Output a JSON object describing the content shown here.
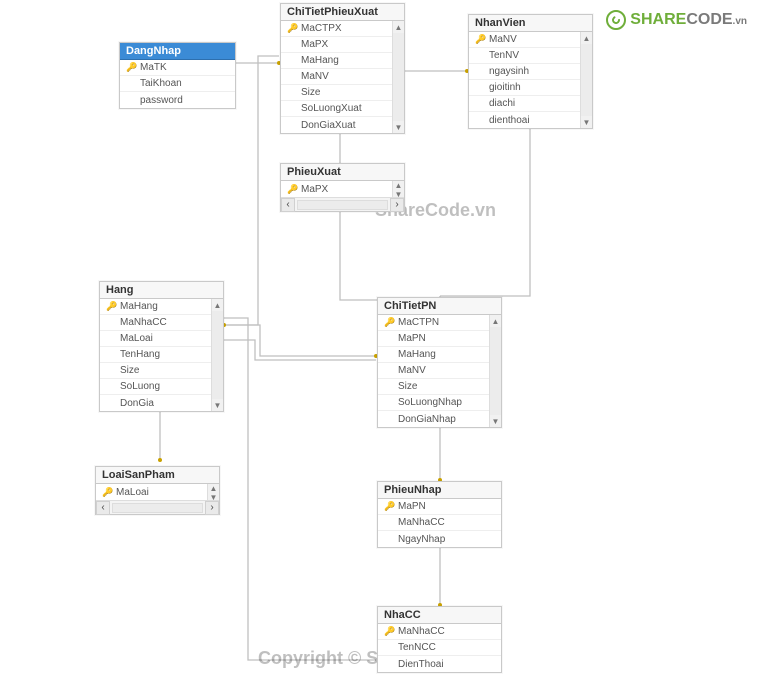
{
  "brand": {
    "share": "SHARE",
    "code": "CODE",
    "vn": ".vn"
  },
  "watermarks": {
    "w1": "ShareCode.vn",
    "w2": "Copyright © ShareCode.vn"
  },
  "tables": {
    "DangNhap": {
      "title": "DangNhap",
      "fields": [
        {
          "k": true,
          "n": "MaTK"
        },
        {
          "k": false,
          "n": "TaiKhoan"
        },
        {
          "k": false,
          "n": "password"
        }
      ]
    },
    "ChiTietPhieuXuat": {
      "title": "ChiTietPhieuXuat",
      "fields": [
        {
          "k": true,
          "n": "MaCTPX"
        },
        {
          "k": false,
          "n": "MaPX"
        },
        {
          "k": false,
          "n": "MaHang"
        },
        {
          "k": false,
          "n": "MaNV"
        },
        {
          "k": false,
          "n": "Size"
        },
        {
          "k": false,
          "n": "SoLuongXuat"
        },
        {
          "k": false,
          "n": "DonGiaXuat"
        }
      ]
    },
    "NhanVien": {
      "title": "NhanVien",
      "fields": [
        {
          "k": true,
          "n": "MaNV"
        },
        {
          "k": false,
          "n": "TenNV"
        },
        {
          "k": false,
          "n": "ngaysinh"
        },
        {
          "k": false,
          "n": "gioitinh"
        },
        {
          "k": false,
          "n": "diachi"
        },
        {
          "k": false,
          "n": "dienthoai"
        }
      ]
    },
    "PhieuXuat": {
      "title": "PhieuXuat",
      "fields": [
        {
          "k": true,
          "n": "MaPX"
        }
      ]
    },
    "Hang": {
      "title": "Hang",
      "fields": [
        {
          "k": true,
          "n": "MaHang"
        },
        {
          "k": false,
          "n": "MaNhaCC"
        },
        {
          "k": false,
          "n": "MaLoai"
        },
        {
          "k": false,
          "n": "TenHang"
        },
        {
          "k": false,
          "n": "Size"
        },
        {
          "k": false,
          "n": "SoLuong"
        },
        {
          "k": false,
          "n": "DonGia"
        }
      ]
    },
    "ChiTietPN": {
      "title": "ChiTietPN",
      "fields": [
        {
          "k": true,
          "n": "MaCTPN"
        },
        {
          "k": false,
          "n": "MaPN"
        },
        {
          "k": false,
          "n": "MaHang"
        },
        {
          "k": false,
          "n": "MaNV"
        },
        {
          "k": false,
          "n": "Size"
        },
        {
          "k": false,
          "n": "SoLuongNhap"
        },
        {
          "k": false,
          "n": "DonGiaNhap"
        }
      ]
    },
    "LoaiSanPham": {
      "title": "LoaiSanPham",
      "fields": [
        {
          "k": true,
          "n": "MaLoai"
        }
      ]
    },
    "PhieuNhap": {
      "title": "PhieuNhap",
      "fields": [
        {
          "k": true,
          "n": "MaPN"
        },
        {
          "k": false,
          "n": "MaNhaCC"
        },
        {
          "k": false,
          "n": "NgayNhap"
        }
      ]
    },
    "NhaCC": {
      "title": "NhaCC",
      "fields": [
        {
          "k": true,
          "n": "MaNhaCC"
        },
        {
          "k": false,
          "n": "TenNCC"
        },
        {
          "k": false,
          "n": "DienThoai"
        }
      ]
    }
  },
  "relations": [
    {
      "from": "DangNhap.MaTK",
      "to": "ChiTietPhieuXuat"
    },
    {
      "from": "ChiTietPhieuXuat.MaNV",
      "to": "NhanVien.MaNV"
    },
    {
      "from": "ChiTietPhieuXuat.MaPX",
      "to": "PhieuXuat.MaPX"
    },
    {
      "from": "ChiTietPhieuXuat.MaHang",
      "to": "Hang.MaHang"
    },
    {
      "from": "NhanVien.MaNV",
      "to": "ChiTietPN.MaNV"
    },
    {
      "from": "Hang.MaLoai",
      "to": "LoaiSanPham.MaLoai"
    },
    {
      "from": "Hang.MaHang",
      "to": "ChiTietPN.MaHang"
    },
    {
      "from": "Hang.MaNhaCC",
      "to": "NhaCC.MaNhaCC"
    },
    {
      "from": "ChiTietPN.MaPN",
      "to": "PhieuNhap.MaPN"
    },
    {
      "from": "PhieuNhap.MaNhaCC",
      "to": "NhaCC.MaNhaCC"
    }
  ]
}
